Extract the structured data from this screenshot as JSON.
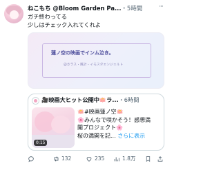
{
  "tweet": {
    "user_name": "ねこもち @Bloom Garden Pa...",
    "time": "・5時間",
    "text_line1": "ガチ終わってる",
    "text_line2": "少しはチェック入れてくれよ",
    "more_label": "···"
  },
  "media": {
    "title": "蓮ノ空の映画でインム泣き。",
    "subtitle": "@さラス・風計・イモスタエンジェルト"
  },
  "quote": {
    "user_name": "🎥映画大ヒット公開中🪷ラ...",
    "time": "・6時間",
    "line1": "🪷#映画蓮ノ空🪷",
    "line2": "🌸みんなで咲かそう！感想満",
    "line3": "開プロジェクト🌸",
    "line4": "桜の満開を記...",
    "show_more": "さらに表示",
    "duration": "0:15"
  },
  "actions": {
    "retweets": "132",
    "likes": "235",
    "views": "1.8万"
  },
  "icons": {
    "reply": "reply-icon",
    "retweet": "retweet-icon",
    "like": "heart-icon",
    "views": "views-icon",
    "bookmark": "bookmark-icon",
    "share": "share-icon"
  },
  "colors": {
    "link": "#1d9bf0",
    "secondary_text": "#536471"
  }
}
